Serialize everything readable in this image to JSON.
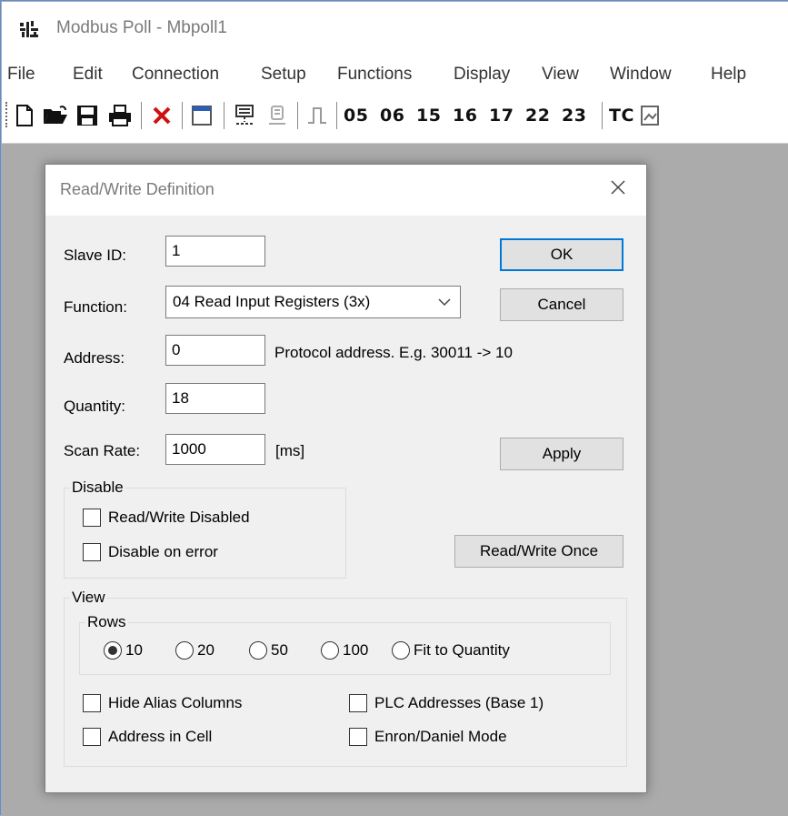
{
  "window": {
    "title": "Modbus Poll - Mbpoll1"
  },
  "menu": [
    "File",
    "Edit",
    "Connection",
    "Setup",
    "Functions",
    "Display",
    "View",
    "Window",
    "Help"
  ],
  "toolbar": {
    "icons": [
      "new-file-icon",
      "open-folder-icon",
      "save-icon",
      "print-icon",
      "delete-icon",
      "window-icon",
      "connect-icon",
      "disconnect-icon",
      "pulse-icon",
      "tc-window-icon"
    ],
    "function_codes": [
      "05",
      "06",
      "15",
      "16",
      "17",
      "22",
      "23"
    ],
    "tc_label": "TC"
  },
  "dialog": {
    "title": "Read/Write Definition",
    "slave_id": {
      "label": "Slave ID:",
      "value": "1"
    },
    "function": {
      "label": "Function:",
      "value": "04 Read Input Registers (3x)"
    },
    "address": {
      "label": "Address:",
      "value": "0",
      "hint": "Protocol address. E.g. 30011 -> 10"
    },
    "quantity": {
      "label": "Quantity:",
      "value": "18"
    },
    "scan_rate": {
      "label": "Scan Rate:",
      "value": "1000",
      "unit": "[ms]"
    },
    "buttons": {
      "ok": "OK",
      "cancel": "Cancel",
      "apply": "Apply",
      "read_write_once": "Read/Write Once"
    },
    "disable_group": {
      "title": "Disable",
      "read_write_disabled": {
        "label": "Read/Write Disabled",
        "checked": false
      },
      "disable_on_error": {
        "label": "Disable on error",
        "checked": false
      }
    },
    "view_group": {
      "title": "View",
      "rows_title": "Rows",
      "rows_options": [
        "10",
        "20",
        "50",
        "100",
        "Fit to Quantity"
      ],
      "rows_selected": "10",
      "hide_alias_columns": {
        "label": "Hide Alias Columns",
        "checked": false
      },
      "plc_addresses": {
        "label": "PLC Addresses (Base 1)",
        "checked": false
      },
      "address_in_cell": {
        "label": "Address in Cell",
        "checked": false
      },
      "enron_daniel_mode": {
        "label": "Enron/Daniel Mode",
        "checked": false
      }
    }
  },
  "colors": {
    "accent": "#0078d7",
    "workspace": "#ababab",
    "dialog_bg": "#f0f0f0"
  }
}
